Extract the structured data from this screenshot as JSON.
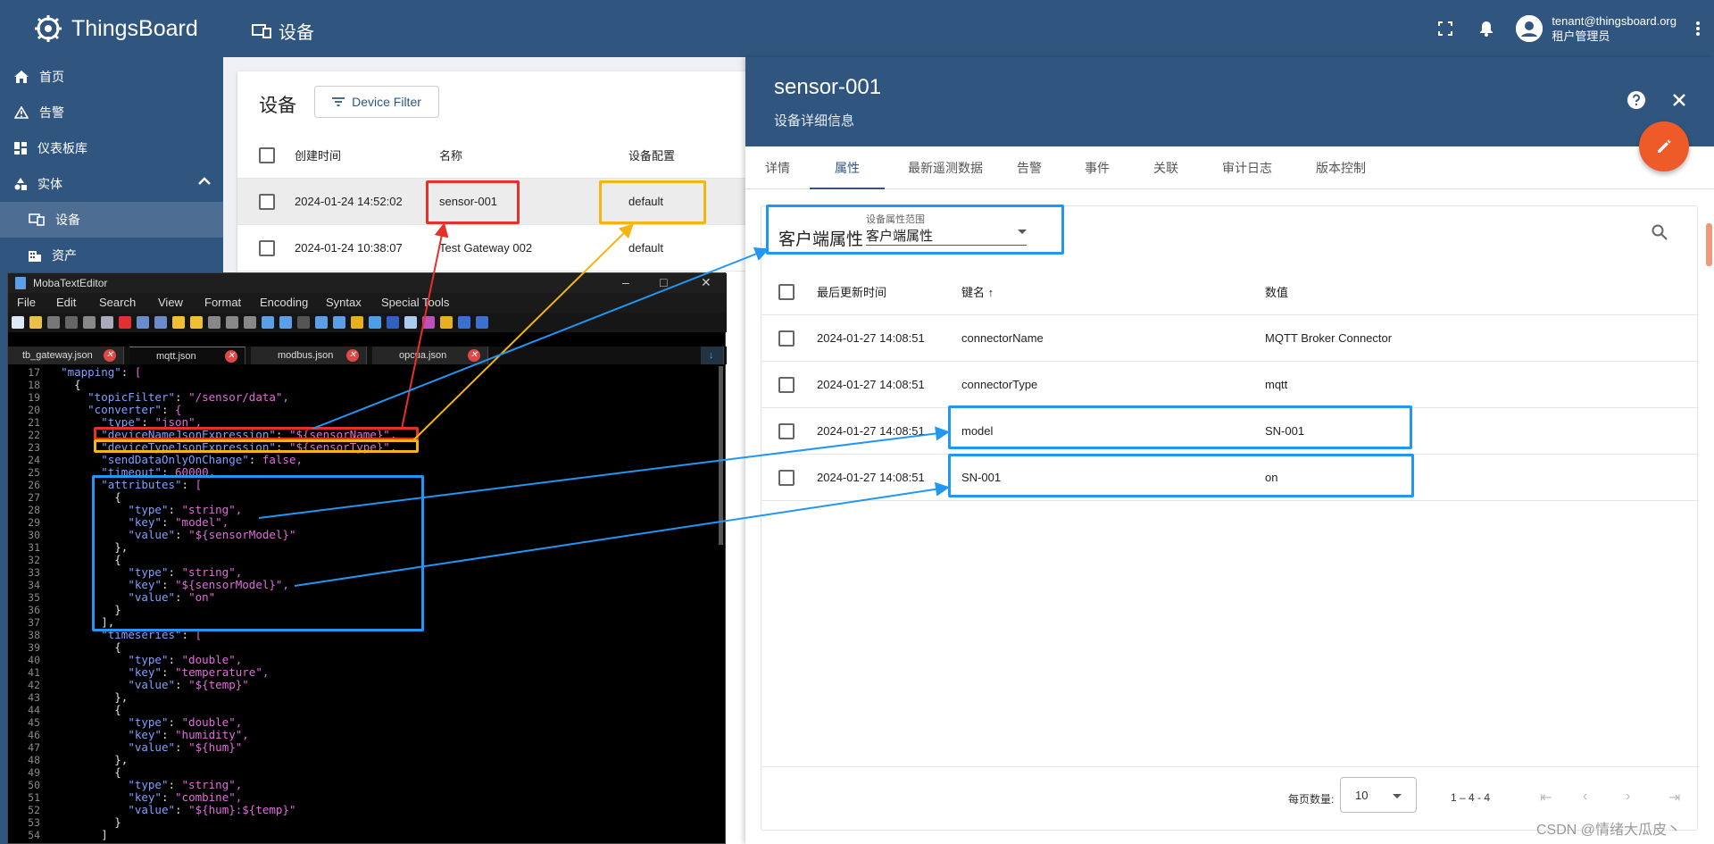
{
  "app": {
    "name": "ThingsBoard"
  },
  "header": {
    "page_title": "设备",
    "user_email": "tenant@thingsboard.org",
    "user_role": "租户管理员"
  },
  "sidebar": {
    "items": [
      {
        "label": "首页",
        "icon": "home-icon"
      },
      {
        "label": "告警",
        "icon": "warning-icon"
      },
      {
        "label": "仪表板库",
        "icon": "dashboard-icon"
      },
      {
        "label": "实体",
        "icon": "entity-icon"
      },
      {
        "label": "设备",
        "icon": "device-icon"
      },
      {
        "label": "资产",
        "icon": "asset-icon"
      }
    ]
  },
  "device_list": {
    "title": "设备",
    "filter_button": "Device Filter",
    "columns": [
      "创建时间",
      "名称",
      "设备配置"
    ],
    "rows": [
      {
        "created": "2024-01-24 14:52:02",
        "name": "sensor-001",
        "profile": "default"
      },
      {
        "created": "2024-01-24 10:38:07",
        "name": "Test Gateway 002",
        "profile": "default"
      }
    ]
  },
  "details": {
    "title": "sensor-001",
    "subtitle": "设备详细信息",
    "tabs": [
      "详情",
      "属性",
      "最新遥测数据",
      "告警",
      "事件",
      "关联",
      "审计日志",
      "版本控制"
    ],
    "active_tab": "属性",
    "attributes": {
      "scope_title": "客户端属性",
      "scope_label": "设备属性范围",
      "scope_value": "客户端属性",
      "columns": [
        "最后更新时间",
        "键名 ↑",
        "数值"
      ],
      "rows": [
        {
          "time": "2024-01-27 14:08:51",
          "key": "connectorName",
          "value": "MQTT Broker Connector"
        },
        {
          "time": "2024-01-27 14:08:51",
          "key": "connectorType",
          "value": "mqtt"
        },
        {
          "time": "2024-01-27 14:08:51",
          "key": "model",
          "value": "SN-001"
        },
        {
          "time": "2024-01-27 14:08:51",
          "key": "SN-001",
          "value": "on"
        }
      ],
      "page_size_label": "每页数量:",
      "page_size": "10",
      "range": "1 – 4 - 4"
    }
  },
  "editor": {
    "title": "MobaTextEditor",
    "menu": [
      "File",
      "Edit",
      "Search",
      "View",
      "Format",
      "Encoding",
      "Syntax",
      "Special Tools"
    ],
    "tabs": [
      "tb_gateway.json",
      "mqtt.json",
      "modbus.json",
      "opcua.json"
    ],
    "active_tab": "mqtt.json",
    "line_numbers": [
      "17",
      "18",
      "19",
      "20",
      "21",
      "22",
      "23",
      "24",
      "25",
      "26",
      "27",
      "28",
      "29",
      "30",
      "31",
      "32",
      "33",
      "34",
      "35",
      "36",
      "37",
      "38",
      "39",
      "40",
      "41",
      "42",
      "43",
      "44",
      "45",
      "46",
      "47",
      "48",
      "49",
      "50",
      "51",
      "52",
      "53",
      "54"
    ],
    "lines": [
      "  \"mapping\": [",
      "    {",
      "      \"topicFilter\": \"/sensor/data\",",
      "      \"converter\": {",
      "        \"type\": \"json\",",
      "        \"deviceNameJsonExpression\": \"${sensorName}\",",
      "        \"deviceTypeJsonExpression\": \"${sensorType}\",",
      "        \"sendDataOnlyOnChange\": false,",
      "        \"timeout\": 60000,",
      "        \"attributes\": [",
      "          {",
      "            \"type\": \"string\",",
      "            \"key\": \"model\",",
      "            \"value\": \"${sensorModel}\"",
      "          },",
      "          {",
      "            \"type\": \"string\",",
      "            \"key\": \"${sensorModel}\",",
      "            \"value\": \"on\"",
      "          }",
      "        ],",
      "        \"timeseries\": [",
      "          {",
      "            \"type\": \"double\",",
      "            \"key\": \"temperature\",",
      "            \"value\": \"${temp}\"",
      "          },",
      "          {",
      "            \"type\": \"double\",",
      "            \"key\": \"humidity\",",
      "            \"value\": \"${hum}\"",
      "          },",
      "          {",
      "            \"type\": \"string\",",
      "            \"key\": \"combine\",",
      "            \"value\": \"${hum}:${temp}\"",
      "          }",
      "        ]"
    ]
  },
  "watermark": "CSDN @情绪大瓜皮丶",
  "colors": {
    "primary": "#305680",
    "fab": "#ee5a28",
    "highlight_red": "#e8302a",
    "highlight_yellow": "#f5b50f",
    "highlight_blue": "#2196f3"
  }
}
